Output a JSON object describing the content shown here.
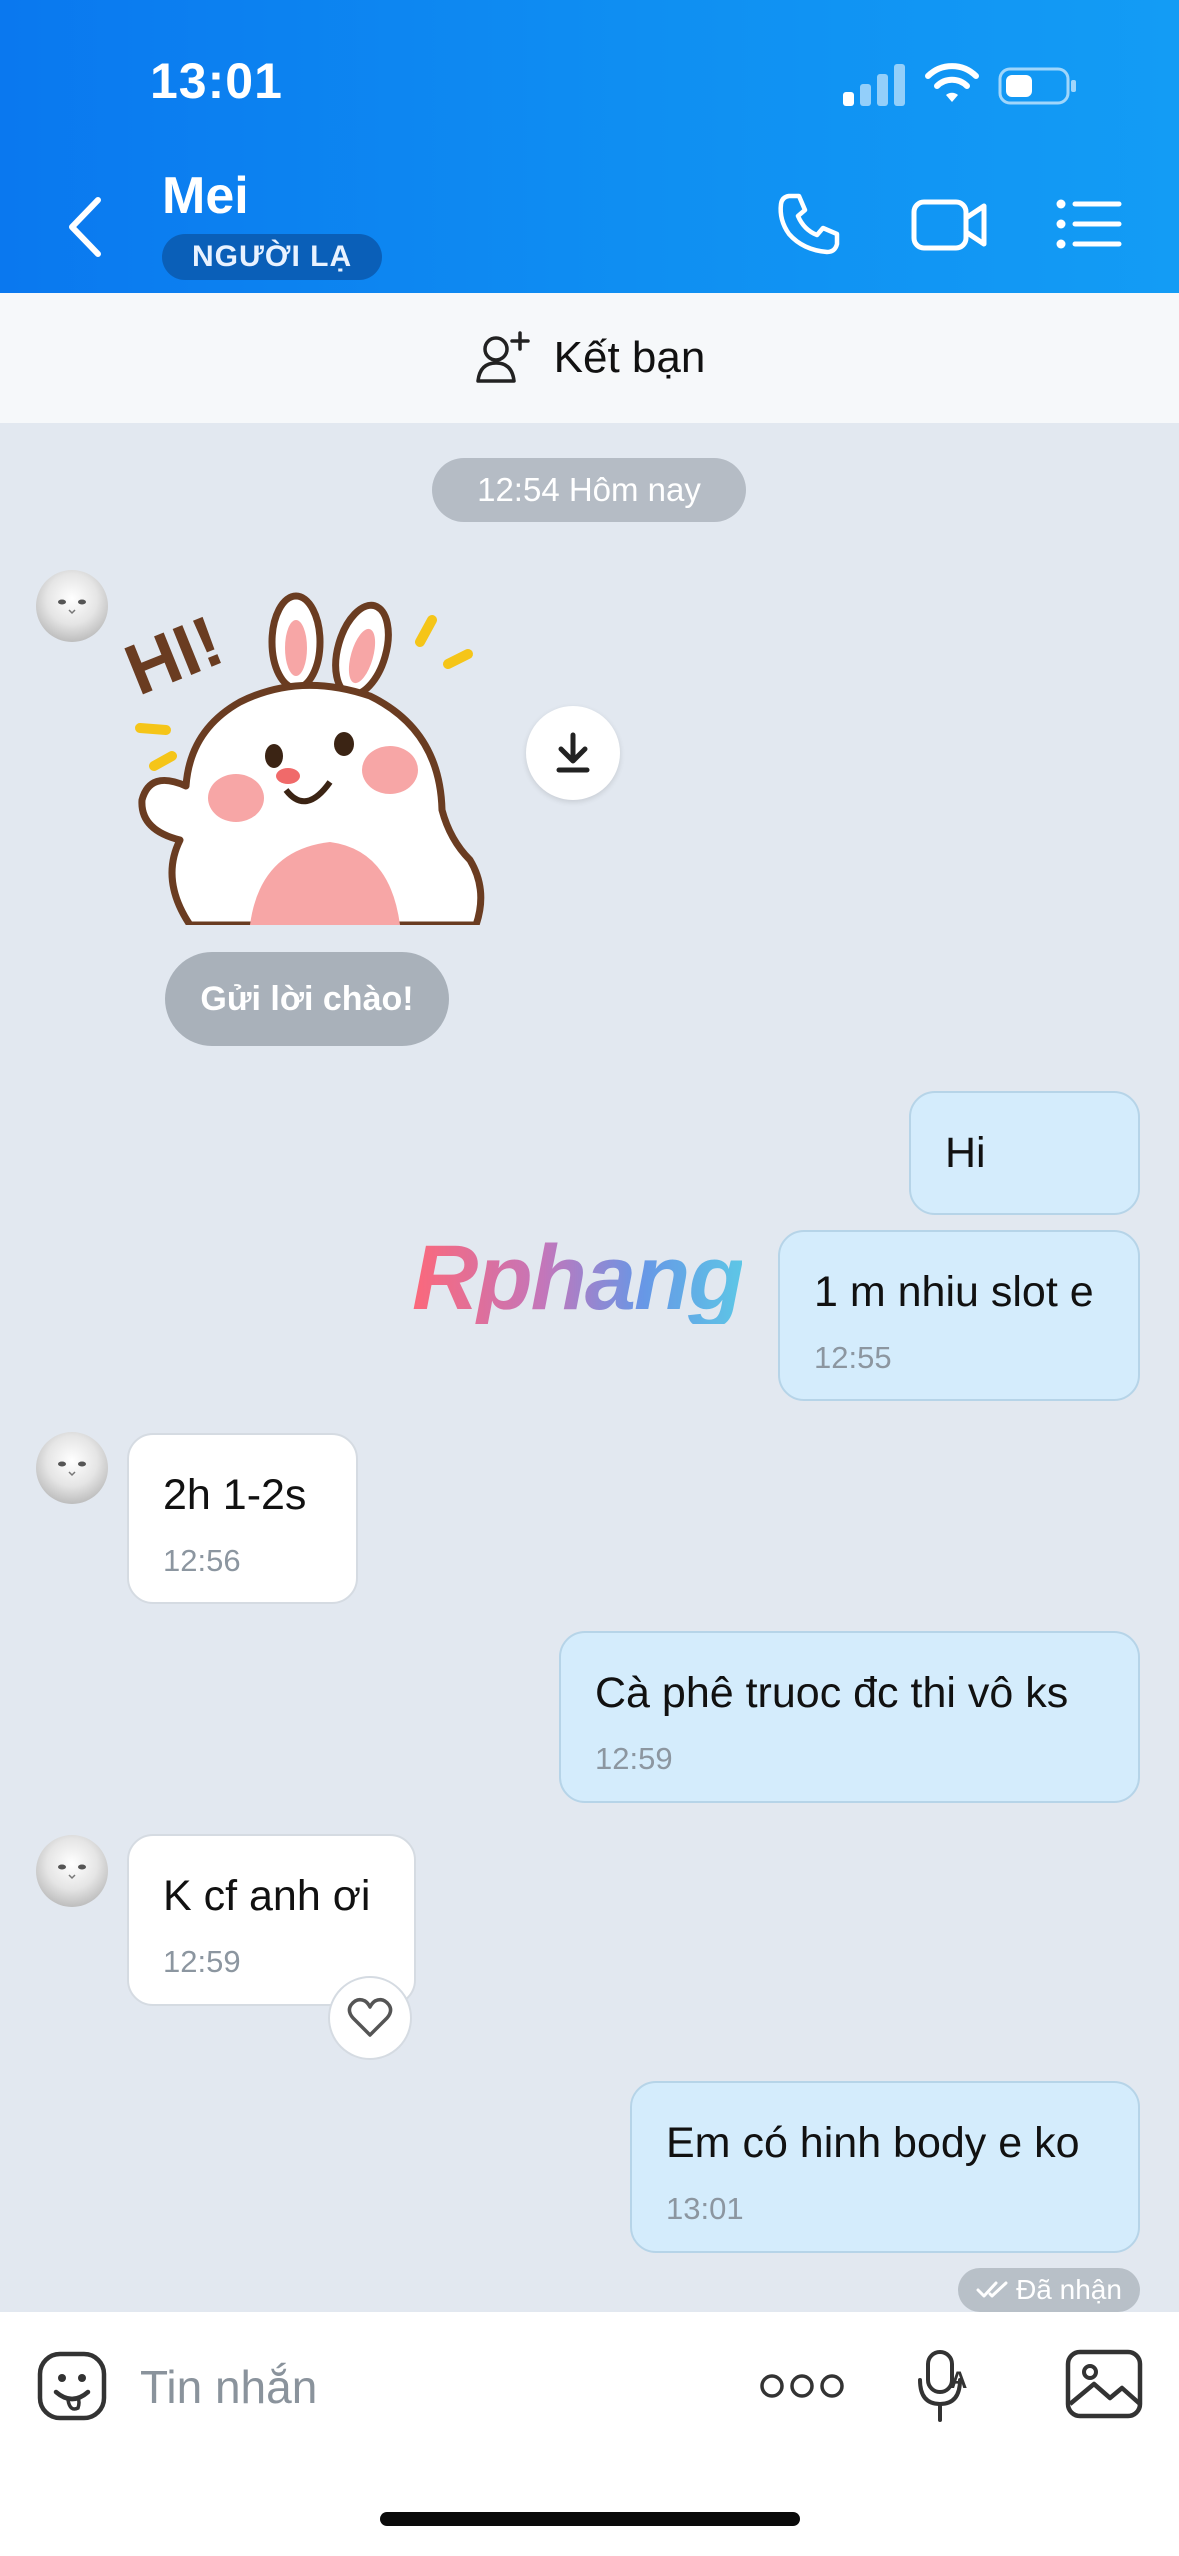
{
  "status_bar": {
    "time": "13:01"
  },
  "header": {
    "contact_name": "Mei",
    "badge": "NGƯỜI LẠ",
    "icons": [
      "back-icon",
      "phone-icon",
      "video-call-icon",
      "list-menu-icon"
    ]
  },
  "friend_bar": {
    "label": "Kết bạn",
    "icon": "add-friend-icon"
  },
  "chat": {
    "date_chip": "12:54 Hôm nay",
    "sticker_text": "HI!",
    "greet_button": "Gửi lời chào!",
    "watermark": "Rphang",
    "messages": [
      {
        "dir": "out",
        "text": "Hi",
        "time": ""
      },
      {
        "dir": "out",
        "text": "1 m nhiu slot e",
        "time": "12:55"
      },
      {
        "dir": "in",
        "text": "2h 1-2s",
        "time": "12:56"
      },
      {
        "dir": "out",
        "text": "Cà phê truoc đc thi vô ks",
        "time": "12:59"
      },
      {
        "dir": "in",
        "text": "K cf anh ơi",
        "time": "12:59"
      },
      {
        "dir": "out",
        "text": "Em có hinh body e ko",
        "time": "13:01"
      }
    ],
    "delivered_status": "Đã nhận"
  },
  "input_bar": {
    "placeholder": "Tin nhắn",
    "icons": [
      "emoji-icon",
      "more-icon",
      "voice-to-text-icon",
      "image-icon"
    ]
  },
  "colors": {
    "header_start": "#0a78ef",
    "header_end": "#139cf5",
    "outgoing_bubble": "#d4ecfc",
    "incoming_bubble": "#ffffff",
    "chat_background": "#e2e8f0"
  }
}
